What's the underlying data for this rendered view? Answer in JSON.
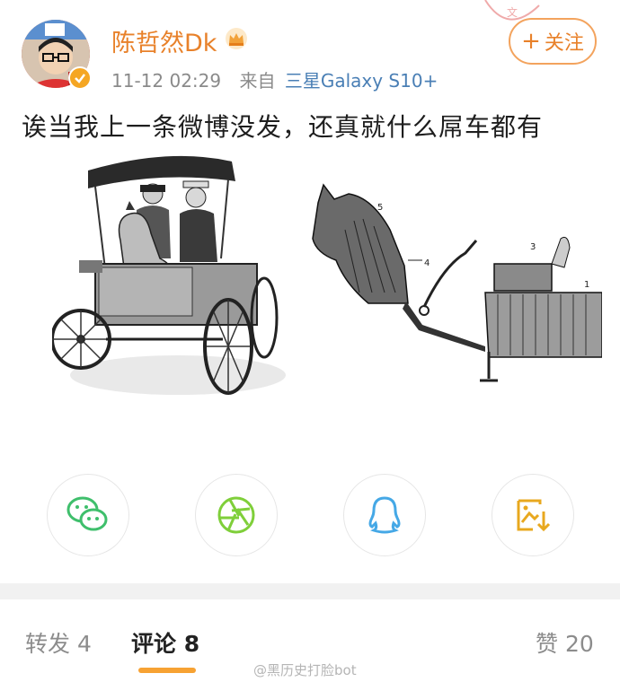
{
  "post": {
    "username": "陈哲然Dk",
    "timestamp": "11-12 02:29",
    "source_label": "来自",
    "device": "三星Galaxy S10+",
    "follow_label": "关注",
    "text": "诶当我上一条微博没发，还真就什么屌车都有"
  },
  "share": {
    "icons": [
      "wechat-icon",
      "moments-icon",
      "qq-icon",
      "save-image-icon"
    ]
  },
  "tabs": [
    {
      "label": "转发",
      "count": "4"
    },
    {
      "label": "评论",
      "count": "8"
    },
    {
      "label": "赞",
      "count": "20"
    }
  ],
  "watermark": "@黑历史打脸bot",
  "colors": {
    "accent": "#e8812a",
    "link": "#4a7fb5",
    "tab_underline": "#f7a233",
    "wechat": "#3fbf6c",
    "moments": "#7fcf3a",
    "qq": "#45a8e6",
    "save": "#e8a81f"
  }
}
